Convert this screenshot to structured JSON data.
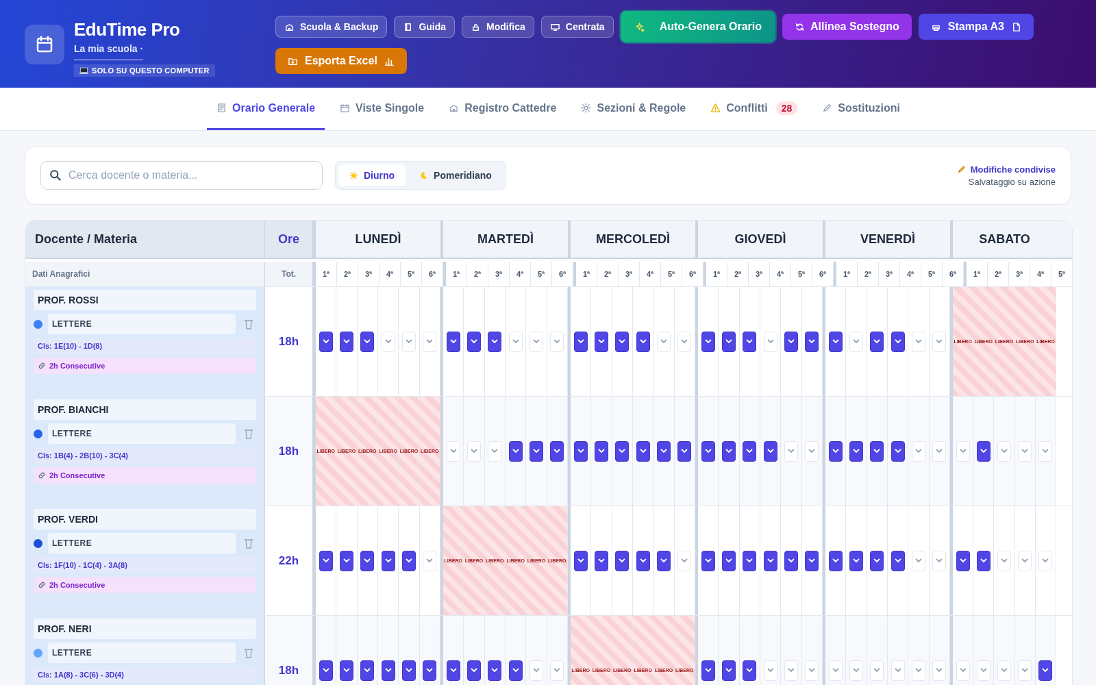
{
  "app": {
    "title": "EduTime Pro",
    "subtitle": "La mia scuola ·",
    "storage_badge": "SOLO SU QUESTO COMPUTER"
  },
  "actions": [
    {
      "label": "Scuola & Backup",
      "kind": "ghost"
    },
    {
      "label": "Guida",
      "kind": "ghost"
    },
    {
      "label": "Modifica",
      "kind": "ghost"
    },
    {
      "label": "Centrata",
      "kind": "ghost"
    },
    {
      "label": "Auto-Genera Orario",
      "kind": "success"
    },
    {
      "label": "Allinea Sostegno",
      "kind": "purple"
    },
    {
      "label": "Stampa A3",
      "kind": "indigo"
    },
    {
      "label": "Esporta Excel",
      "kind": "orange"
    }
  ],
  "tabs": [
    {
      "label": "Orario Generale",
      "selected": true
    },
    {
      "label": "Viste Singole",
      "selected": false
    },
    {
      "label": "Registro Cattedre",
      "selected": false
    },
    {
      "label": "Sezioni & Regole",
      "selected": false
    },
    {
      "label": "Conflitti",
      "selected": false,
      "badge": "28"
    },
    {
      "label": "Sostituzioni",
      "selected": false
    }
  ],
  "filters": {
    "search": {
      "placeholder": "Cerca docente o materia..."
    },
    "shift": [
      {
        "label": "Diurno",
        "selected": true
      },
      {
        "label": "Pomeridiano",
        "selected": false
      }
    ],
    "sync_title": "Modifiche condivise",
    "sync_note": "Salvataggio su azione"
  },
  "table": {
    "name_header": "Docente / Materia",
    "hours_header": "Ore",
    "name_subheader": "Dati Anagrafici",
    "hours_subheader": "Tot.",
    "days": [
      {
        "name": "LUNEDÌ",
        "periods": [
          "1ª",
          "2ª",
          "3ª",
          "4ª",
          "5ª",
          "6ª"
        ]
      },
      {
        "name": "MARTEDÌ",
        "periods": [
          "1ª",
          "2ª",
          "3ª",
          "4ª",
          "5ª",
          "6ª"
        ]
      },
      {
        "name": "MERCOLEDÌ",
        "periods": [
          "1ª",
          "2ª",
          "3ª",
          "4ª",
          "5ª",
          "6ª"
        ]
      },
      {
        "name": "GIOVEDÌ",
        "periods": [
          "1ª",
          "2ª",
          "3ª",
          "4ª",
          "5ª",
          "6ª"
        ]
      },
      {
        "name": "VENERDÌ",
        "periods": [
          "1ª",
          "2ª",
          "3ª",
          "4ª",
          "5ª",
          "6ª"
        ]
      },
      {
        "name": "SABATO",
        "periods": [
          "1ª",
          "2ª",
          "3ª",
          "4ª",
          "5ª"
        ]
      }
    ],
    "teachers": [
      {
        "name": "PROF. ROSSI",
        "subject": "LETTERE",
        "color": "#3b82f6",
        "classes": "Cls: 1E(10) - 1D(8)",
        "constraint": "2h Consecutive",
        "hours": "18h",
        "days": [
          {
            "free": false,
            "assigned": [
              true,
              true,
              true,
              false,
              false,
              false
            ]
          },
          {
            "free": false,
            "assigned": [
              true,
              true,
              true,
              false,
              false,
              false
            ]
          },
          {
            "free": false,
            "assigned": [
              true,
              true,
              true,
              true,
              false,
              false
            ]
          },
          {
            "free": false,
            "assigned": [
              true,
              true,
              true,
              false,
              true,
              true
            ]
          },
          {
            "free": false,
            "assigned": [
              true,
              false,
              true,
              true,
              false,
              false
            ]
          },
          {
            "free": true,
            "labels": [
              "LIBERO",
              "LIBERO",
              "LIBERO",
              "LIBERO",
              "LIBERO"
            ]
          }
        ]
      },
      {
        "name": "PROF. BIANCHI",
        "subject": "LETTERE",
        "color": "#2563eb",
        "classes": "Cls: 1B(4) - 2B(10) - 3C(4)",
        "constraint": "2h Consecutive",
        "hours": "18h",
        "days": [
          {
            "free": true,
            "labels": [
              "LIBERO",
              "LIBERO",
              "LIBERO",
              "LIBERO",
              "LIBERO",
              "LIBERO"
            ]
          },
          {
            "free": false,
            "assigned": [
              false,
              false,
              false,
              true,
              true,
              true
            ]
          },
          {
            "free": false,
            "assigned": [
              true,
              true,
              true,
              true,
              true,
              true
            ]
          },
          {
            "free": false,
            "assigned": [
              true,
              true,
              true,
              true,
              false,
              false
            ]
          },
          {
            "free": false,
            "assigned": [
              true,
              true,
              true,
              true,
              false,
              false
            ]
          },
          {
            "free": false,
            "assigned": [
              false,
              true,
              false,
              false,
              false
            ]
          }
        ]
      },
      {
        "name": "PROF. VERDI",
        "subject": "LETTERE",
        "color": "#1d4ed8",
        "classes": "Cls: 1F(10) - 1C(4) - 3A(8)",
        "constraint": "2h Consecutive",
        "hours": "22h",
        "days": [
          {
            "free": false,
            "assigned": [
              true,
              true,
              true,
              true,
              true,
              false
            ]
          },
          {
            "free": true,
            "labels": [
              "LIBERO",
              "LIBERO",
              "LIBERO",
              "LIBERO",
              "LIBERO",
              "LIBERO"
            ]
          },
          {
            "free": false,
            "assigned": [
              true,
              true,
              true,
              true,
              true,
              false
            ]
          },
          {
            "free": false,
            "assigned": [
              true,
              true,
              true,
              true,
              true,
              true
            ]
          },
          {
            "free": false,
            "assigned": [
              true,
              true,
              true,
              true,
              false,
              false
            ]
          },
          {
            "free": false,
            "assigned": [
              true,
              true,
              false,
              false,
              false
            ]
          }
        ]
      },
      {
        "name": "PROF. NERI",
        "subject": "LETTERE",
        "color": "#60a5fa",
        "classes": "Cls: 1A(8) - 3C(6) - 3D(4)",
        "hours": "18h",
        "days": [
          {
            "free": false,
            "assigned": [
              true,
              true,
              true,
              true,
              true,
              true
            ]
          },
          {
            "free": false,
            "assigned": [
              true,
              true,
              true,
              true,
              false,
              false
            ]
          },
          {
            "free": true,
            "labels": [
              "LIBERO",
              "LIBERO",
              "LIBERO",
              "LIBERO",
              "LIBERO",
              "LIBERO"
            ]
          },
          {
            "free": false,
            "assigned": [
              true,
              true,
              true,
              false,
              false,
              false
            ]
          },
          {
            "free": false,
            "assigned": [
              false,
              false,
              false,
              false,
              false,
              false
            ]
          },
          {
            "free": false,
            "assigned": [
              false,
              false,
              false,
              false,
              true
            ]
          }
        ]
      }
    ]
  }
}
